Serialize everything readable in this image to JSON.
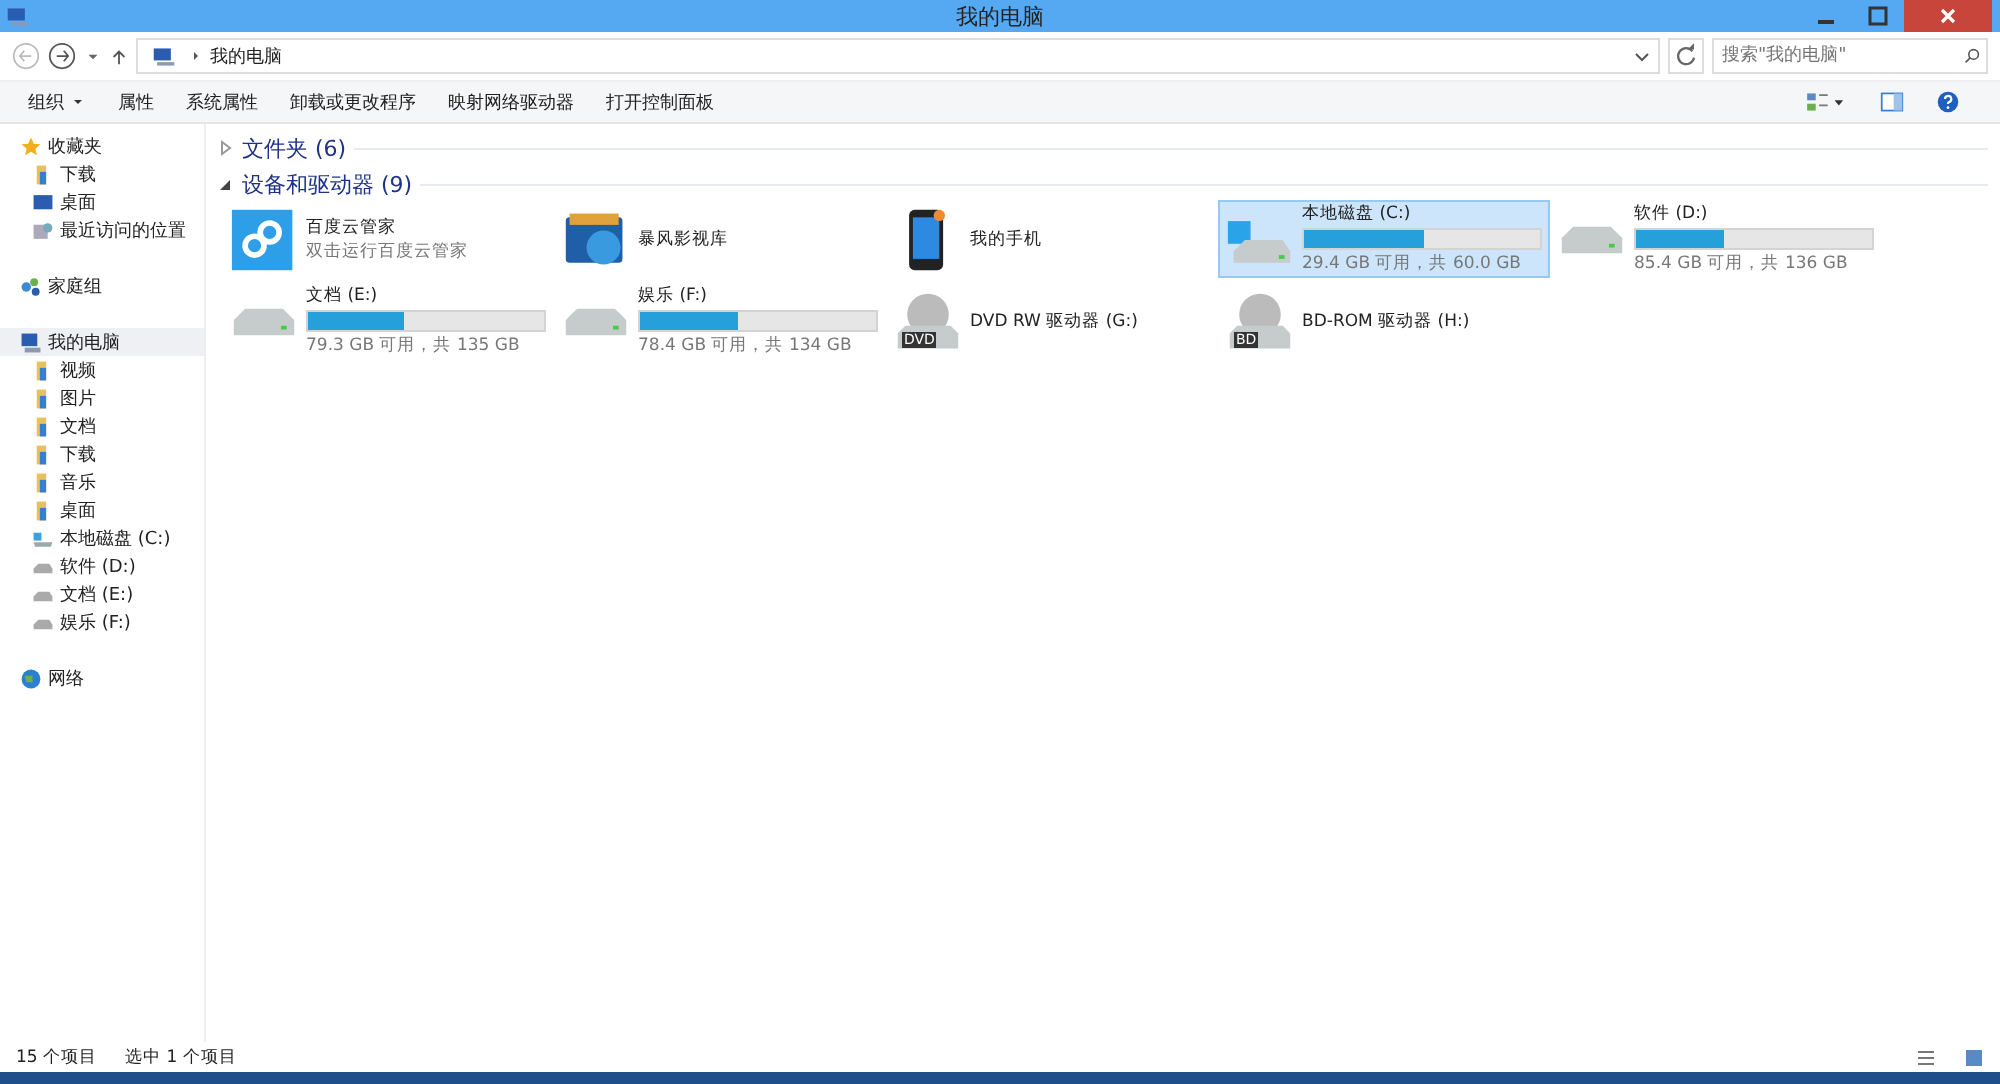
{
  "window": {
    "title": "我的电脑"
  },
  "address": {
    "path": "我的电脑",
    "search_placeholder": "搜索\"我的电脑\""
  },
  "toolbar": [
    {
      "label": "组织",
      "dropdown": true
    },
    {
      "label": "属性",
      "dropdown": false
    },
    {
      "label": "系统属性",
      "dropdown": false
    },
    {
      "label": "卸载或更改程序",
      "dropdown": false
    },
    {
      "label": "映射网络驱动器",
      "dropdown": false
    },
    {
      "label": "打开控制面板",
      "dropdown": false
    }
  ],
  "sidebar": [
    {
      "label": "收藏夹",
      "kind": "favorites",
      "selected": false,
      "children": [
        {
          "label": "下载",
          "kind": "folder",
          "selected": false
        },
        {
          "label": "桌面",
          "kind": "desktop",
          "selected": false
        },
        {
          "label": "最近访问的位置",
          "kind": "recent",
          "selected": false
        }
      ]
    },
    {
      "label": "家庭组",
      "kind": "homegroup",
      "selected": false
    },
    {
      "label": "我的电脑",
      "kind": "computer",
      "selected": true,
      "children": [
        {
          "label": "视频",
          "kind": "folder",
          "selected": false
        },
        {
          "label": "图片",
          "kind": "folder",
          "selected": false
        },
        {
          "label": "文档",
          "kind": "folder",
          "selected": false
        },
        {
          "label": "下载",
          "kind": "folder",
          "selected": false
        },
        {
          "label": "音乐",
          "kind": "folder",
          "selected": false
        },
        {
          "label": "桌面",
          "kind": "folder",
          "selected": false
        },
        {
          "label": "本地磁盘 (C:)",
          "kind": "windrive",
          "selected": false
        },
        {
          "label": "软件 (D:)",
          "kind": "drive",
          "selected": false
        },
        {
          "label": "文档 (E:)",
          "kind": "drive",
          "selected": false
        },
        {
          "label": "娱乐 (F:)",
          "kind": "drive",
          "selected": false
        }
      ]
    },
    {
      "label": "网络",
      "kind": "network",
      "selected": false
    }
  ],
  "groups": [
    {
      "title": "文件夹 (6)",
      "expanded": false
    },
    {
      "title": "设备和驱动器 (9)",
      "expanded": true,
      "items": [
        {
          "kind": "cloud",
          "name": "百度云管家",
          "subtitle": "双击运行百度云管家",
          "selected": false
        },
        {
          "kind": "library",
          "name": "暴风影视库",
          "selected": false
        },
        {
          "kind": "phone",
          "name": "我的手机",
          "selected": false
        },
        {
          "kind": "windrive",
          "name": "本地磁盘 (C:)",
          "level": 0.51,
          "info": "29.4 GB 可用，共 60.0 GB",
          "selected": true
        },
        {
          "kind": "drive",
          "name": "软件 (D:)",
          "level": 0.37,
          "info": "85.4 GB 可用，共 136 GB",
          "selected": false
        },
        {
          "kind": "drive",
          "name": "文档 (E:)",
          "level": 0.41,
          "info": "79.3 GB 可用，共 135 GB",
          "selected": false
        },
        {
          "kind": "drive",
          "name": "娱乐 (F:)",
          "level": 0.415,
          "info": "78.4 GB 可用，共 134 GB",
          "selected": false
        },
        {
          "kind": "disc",
          "badge": "DVD",
          "name": "DVD RW 驱动器 (G:)",
          "selected": false
        },
        {
          "kind": "disc",
          "badge": "BD",
          "name": "BD-ROM 驱动器 (H:)",
          "selected": false
        }
      ]
    }
  ],
  "status_bar": {
    "count": "15 个项目",
    "selection": "选中 1 个项目"
  }
}
